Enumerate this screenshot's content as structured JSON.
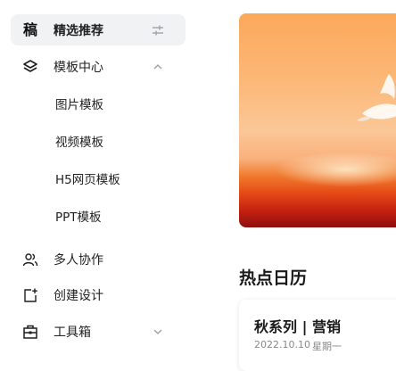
{
  "sidebar": {
    "featured": {
      "icon_char": "稿",
      "label": "精选推荐",
      "tail_icon": "sliders-icon"
    },
    "templates": {
      "label": "模板中心",
      "icon": "layers-icon",
      "tail_icon": "chevron-up-icon",
      "children": [
        "图片模板",
        "视频模板",
        "H5网页模板",
        "PPT模板"
      ]
    },
    "items": [
      {
        "label": "多人协作",
        "icon": "users-icon"
      },
      {
        "label": "创建设计",
        "icon": "create-design-icon"
      },
      {
        "label": "工具箱",
        "icon": "toolbox-icon",
        "tail_icon": "chevron-down-icon"
      }
    ]
  },
  "main": {
    "section_title": "热点日历",
    "event": {
      "title": "秋系列 | 营销",
      "date": "2022.10.10",
      "weekday": "星期一"
    }
  }
}
